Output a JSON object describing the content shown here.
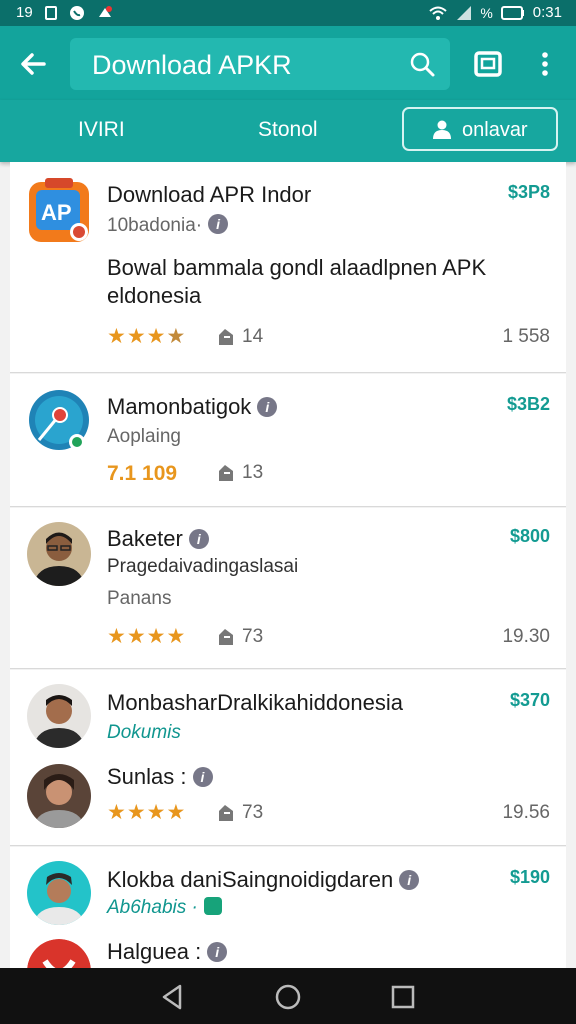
{
  "status_bar": {
    "time_left": "19",
    "battery": "%",
    "time_right": "0:31",
    "left_icons": [
      "sim-icon",
      "whatsapp-icon",
      "notification-icon"
    ],
    "right_icons": [
      "wifi-icon",
      "signal-icon",
      "battery-icon"
    ]
  },
  "app_bar": {
    "search_text": "Download APKR",
    "back_icon": "back-arrow-icon",
    "search_icon": "search-icon",
    "tab_icon": "tabs-icon",
    "more_icon": "more-vert-icon"
  },
  "tabs": [
    {
      "label": "IVIRI"
    },
    {
      "label": "Stonol"
    },
    {
      "label": "onlavar",
      "icon": "user-icon"
    }
  ],
  "colors": {
    "primary": "#13a49c",
    "status": "#0b6f6a",
    "price": "#139b92",
    "star": "#e8961d"
  },
  "items": [
    {
      "title": "Download APR Indor",
      "subtitle": "10badonia·",
      "description": "Bowal bammala gondl alaadlpnen APK eldonesia",
      "price": "$3P8",
      "rating_stars": 4,
      "downloads": "14",
      "count": "1 558"
    },
    {
      "title": "Mamonbatigok",
      "subtitle": "Aoplaing",
      "rating_text": "7.1 109",
      "price": "$3B2",
      "downloads": "13"
    },
    {
      "title": "Baketer",
      "subtitle": "Pragedaivadingaslasai",
      "subtitle2": "Panans",
      "price": "$800",
      "rating_stars": 4,
      "downloads": "73",
      "count": "19.30"
    },
    {
      "title": "MonbasharDralkikahiddonesia",
      "subtitle": "Dokumis",
      "title2": "Sunlas :",
      "price": "$370",
      "rating_stars": 4,
      "downloads": "73",
      "count": "19.56"
    },
    {
      "title": "Klokba daniSaingnoidigdaren",
      "subtitle": "Ab6habis ·",
      "title2": "Halguea :",
      "price": "$190"
    }
  ],
  "nav": {
    "back": "nav-back-icon",
    "home": "nav-home-icon",
    "recents": "nav-recents-icon"
  }
}
